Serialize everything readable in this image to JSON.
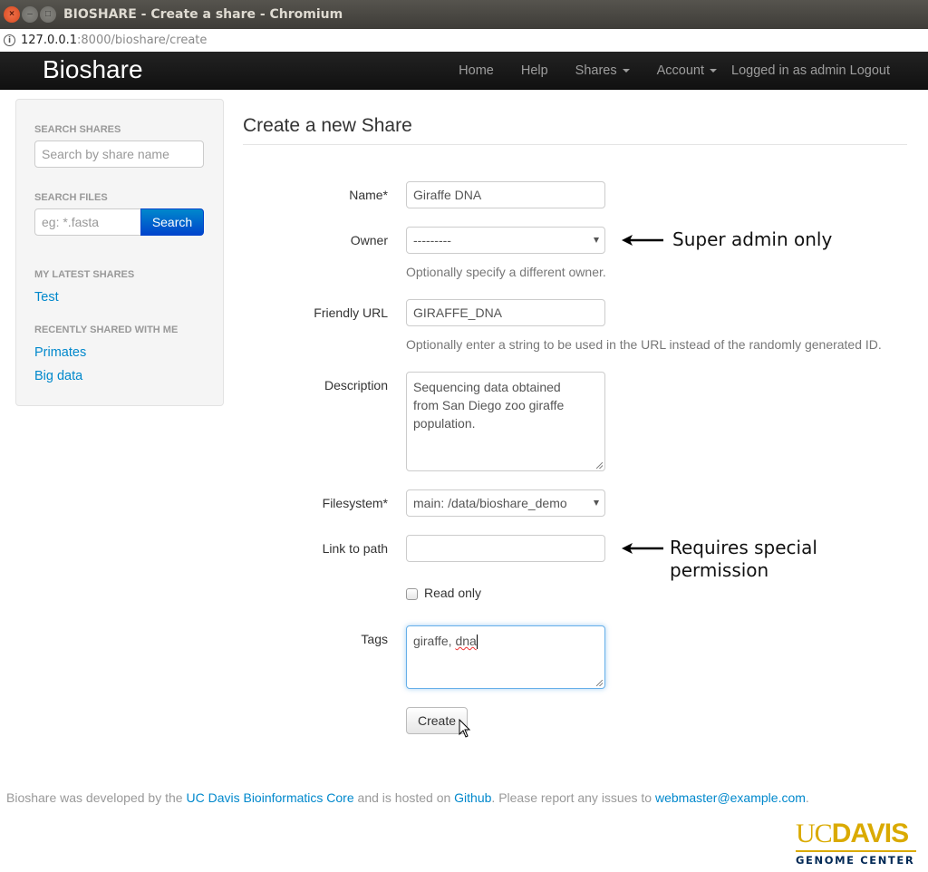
{
  "window": {
    "title": "BIOSHARE - Create a share - Chromium",
    "close_glyph": "×",
    "min_glyph": "–",
    "max_glyph": "□"
  },
  "address_bar": {
    "info_glyph": "i",
    "url_host": "127.0.0.1",
    "url_rest": ":8000/bioshare/create"
  },
  "navbar": {
    "brand": "Bioshare",
    "links": [
      {
        "label": "Home"
      },
      {
        "label": "Help"
      },
      {
        "label": "Shares",
        "dropdown": true
      },
      {
        "label": "Account",
        "dropdown": true
      }
    ],
    "logged_in_text": "Logged in as admin",
    "logout_label": "Logout"
  },
  "sidebar": {
    "search_shares_header": "Search shares",
    "search_shares_placeholder": "Search by share name",
    "search_files_header": "Search files",
    "search_files_placeholder": "eg: *.fasta",
    "search_button": "Search",
    "latest_shares_header": "My latest shares",
    "latest_shares": [
      "Test"
    ],
    "shared_with_me_header": "Recently shared with me",
    "shared_with_me": [
      "Primates",
      "Big data"
    ]
  },
  "form": {
    "title": "Create a new Share",
    "name": {
      "label": "Name*",
      "value": "Giraffe DNA"
    },
    "owner": {
      "label": "Owner",
      "value": "---------",
      "help": "Optionally specify a different owner."
    },
    "friendly_url": {
      "label": "Friendly URL",
      "value": "GIRAFFE_DNA",
      "help": "Optionally enter a string to be used in the URL instead of the randomly generated ID."
    },
    "description": {
      "label": "Description",
      "value": "Sequencing data obtained from San Diego zoo giraffe population."
    },
    "filesystem": {
      "label": "Filesystem*",
      "value": "main: /data/bioshare_demo"
    },
    "link_to_path": {
      "label": "Link to path",
      "value": ""
    },
    "read_only": {
      "label": "Read only",
      "checked": false
    },
    "tags": {
      "label": "Tags",
      "value_prefix": "giraffe, ",
      "value_misspelled": "dna"
    },
    "create_button": "Create"
  },
  "annotations": {
    "owner_note": "Super admin only",
    "link_note_line1": "Requires special",
    "link_note_line2": "permission"
  },
  "footer": {
    "text1": "Bioshare was developed by the ",
    "link1": "UC Davis Bioinformatics Core",
    "text2": " and is hosted on ",
    "link2": "Github",
    "text3": ". Please report any issues to ",
    "link3": "webmaster@example.com",
    "text4": ".",
    "logo_uc": "UC",
    "logo_davis": "DAVIS",
    "logo_sub": "GENOME CENTER"
  },
  "colors": {
    "link": "#0088cc",
    "navbar_bg": "#1b1b1b",
    "logo_gold": "#daaa00",
    "logo_navy": "#002855"
  }
}
